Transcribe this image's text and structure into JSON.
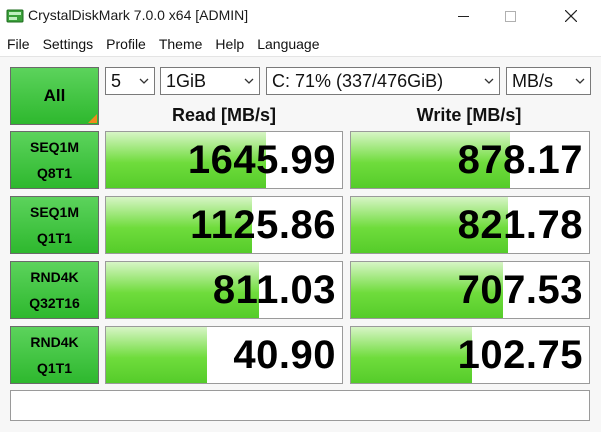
{
  "window": {
    "title": "CrystalDiskMark 7.0.0 x64 [ADMIN]",
    "accent": "#2eb82e"
  },
  "menu": [
    "File",
    "Settings",
    "Profile",
    "Theme",
    "Help",
    "Language"
  ],
  "controls": {
    "all_label": "All",
    "count": "5",
    "size": "1GiB",
    "drive": "C: 71% (337/476GiB)",
    "unit": "MB/s"
  },
  "headers": {
    "read": "Read [MB/s]",
    "write": "Write [MB/s]"
  },
  "rows": [
    {
      "line1": "SEQ1M",
      "line2": "Q8T1",
      "read": "1645.99",
      "write": "878.17",
      "read_fraction": 0.68,
      "write_fraction": 0.67
    },
    {
      "line1": "SEQ1M",
      "line2": "Q1T1",
      "read": "1125.86",
      "write": "821.78",
      "read_fraction": 0.62,
      "write_fraction": 0.66
    },
    {
      "line1": "RND4K",
      "line2": "Q32T16",
      "read": "811.03",
      "write": "707.53",
      "read_fraction": 0.65,
      "write_fraction": 0.64
    },
    {
      "line1": "RND4K",
      "line2": "Q1T1",
      "read": "40.90",
      "write": "102.75",
      "read_fraction": 0.43,
      "write_fraction": 0.51
    }
  ],
  "comment": ""
}
